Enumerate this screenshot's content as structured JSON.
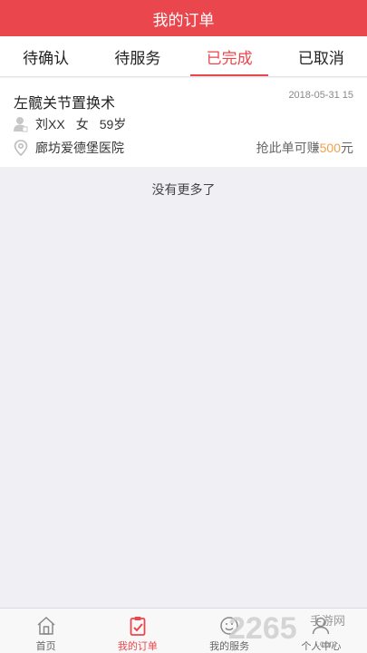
{
  "header": {
    "title": "我的订单"
  },
  "tabs": [
    {
      "label": "待确认"
    },
    {
      "label": "待服务"
    },
    {
      "label": "已完成"
    },
    {
      "label": "已取消"
    }
  ],
  "active_tab": "已完成",
  "order": {
    "title": "左髋关节置换术",
    "date": "2018-05-31 15",
    "patient_name": "刘XX",
    "patient_gender": "女",
    "patient_age": "59岁",
    "hospital": "廊坊爱德堡医院",
    "reward_prefix": "抢此单可赚",
    "reward_amount": "500",
    "reward_unit": "元"
  },
  "list_end_text": "没有更多了",
  "tabbar": [
    {
      "label": "首页",
      "icon": "home-icon"
    },
    {
      "label": "我的订单",
      "icon": "order-clipboard-icon"
    },
    {
      "label": "我的服务",
      "icon": "service-icon"
    },
    {
      "label": "个人中心",
      "icon": "profile-icon"
    }
  ],
  "active_tabbar": "我的订单",
  "colors": {
    "accent": "#e9474d",
    "reward": "#f0a14b"
  }
}
